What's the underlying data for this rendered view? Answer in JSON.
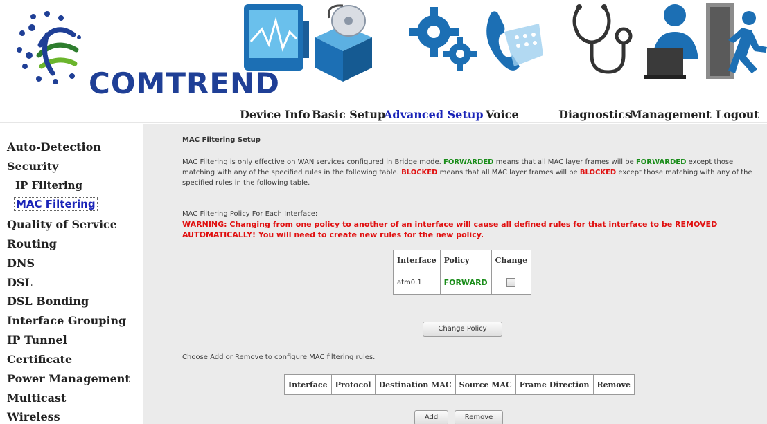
{
  "brand": {
    "name": "COMTREND"
  },
  "nav": [
    {
      "id": "device-info",
      "label": "Device Info",
      "icon": "monitor-graph-icon"
    },
    {
      "id": "basic-setup",
      "label": "Basic Setup",
      "icon": "disc-box-icon"
    },
    {
      "id": "advanced-setup",
      "label": "Advanced Setup",
      "icon": "gears-icon",
      "active": true
    },
    {
      "id": "voice",
      "label": "Voice",
      "icon": "phone-icon"
    },
    {
      "id": "diagnostics",
      "label": "Diagnostics",
      "icon": "stethoscope-icon"
    },
    {
      "id": "management",
      "label": "Management",
      "icon": "user-laptop-icon"
    },
    {
      "id": "logout",
      "label": "Logout",
      "icon": "exit-door-icon"
    }
  ],
  "sidebar": {
    "items": [
      {
        "label": "Auto-Detection"
      },
      {
        "label": "Security"
      },
      {
        "label": "IP Filtering",
        "sub": true
      },
      {
        "label": "MAC Filtering",
        "sub": true,
        "active": true
      },
      {
        "label": "Quality of Service"
      },
      {
        "label": "Routing"
      },
      {
        "label": "DNS"
      },
      {
        "label": "DSL"
      },
      {
        "label": "DSL Bonding"
      },
      {
        "label": "Interface Grouping"
      },
      {
        "label": "IP Tunnel"
      },
      {
        "label": "Certificate"
      },
      {
        "label": "Power Management"
      },
      {
        "label": "Multicast"
      },
      {
        "label": "Wireless"
      }
    ]
  },
  "main": {
    "title": "MAC Filtering Setup",
    "desc": {
      "p1": "MAC Filtering is only effective on WAN services configured in Bridge mode.",
      "forwarded": "FORWARDED",
      "p2": "means that all MAC layer frames will be",
      "p3": "except those matching with any of the specified rules in the following table.",
      "blocked": "BLOCKED",
      "p4": "means that all MAC layer frames will be",
      "p5": "except those matching with any of the specified rules in the following table."
    },
    "policy_heading": "MAC Filtering Policy For Each Interface:",
    "warning": "WARNING: Changing from one policy to another of an interface will cause all defined rules for that interface to be REMOVED AUTOMATICALLY! You will need to create new rules for the new policy.",
    "policy_table": {
      "headers": [
        "Interface",
        "Policy",
        "Change"
      ],
      "rows": [
        {
          "interface": "atm0.1",
          "policy": "FORWARD",
          "change_checked": false
        }
      ]
    },
    "change_policy_button": "Change Policy",
    "rules_hint": "Choose Add or Remove to configure MAC filtering rules.",
    "rules_table": {
      "headers": [
        "Interface",
        "Protocol",
        "Destination MAC",
        "Source MAC",
        "Frame Direction",
        "Remove"
      ]
    },
    "add_button": "Add",
    "remove_button": "Remove"
  },
  "colors": {
    "brand_blue": "#1f3f96",
    "active_link": "#1a24b8",
    "forward_green": "#198c19",
    "warning_red": "#e01010",
    "panel_bg": "#ebebeb"
  }
}
